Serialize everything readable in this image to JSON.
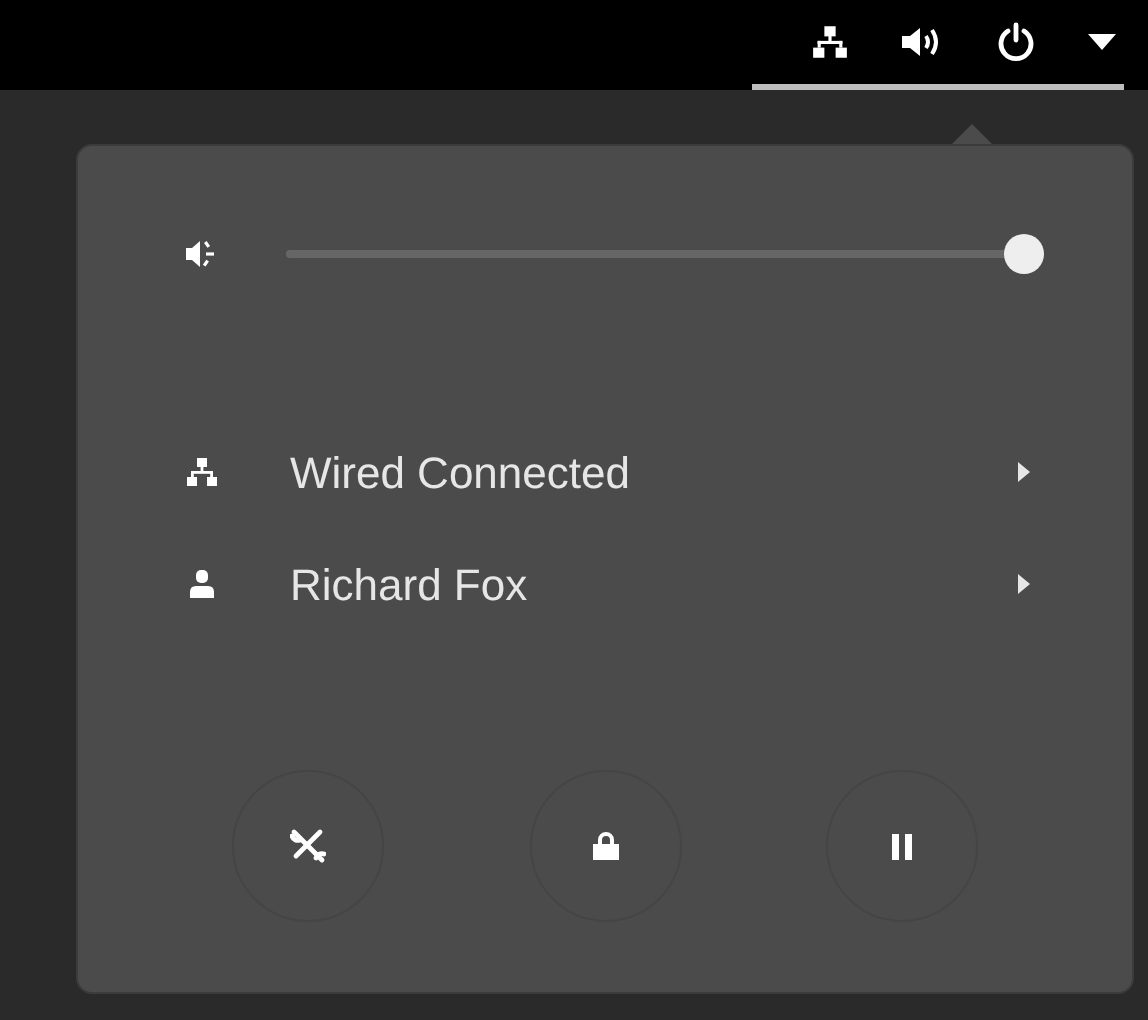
{
  "volume": {
    "level": 1
  },
  "items": [
    {
      "kind": "network",
      "label": "Wired Connected"
    },
    {
      "kind": "user",
      "label": "Richard Fox"
    }
  ]
}
